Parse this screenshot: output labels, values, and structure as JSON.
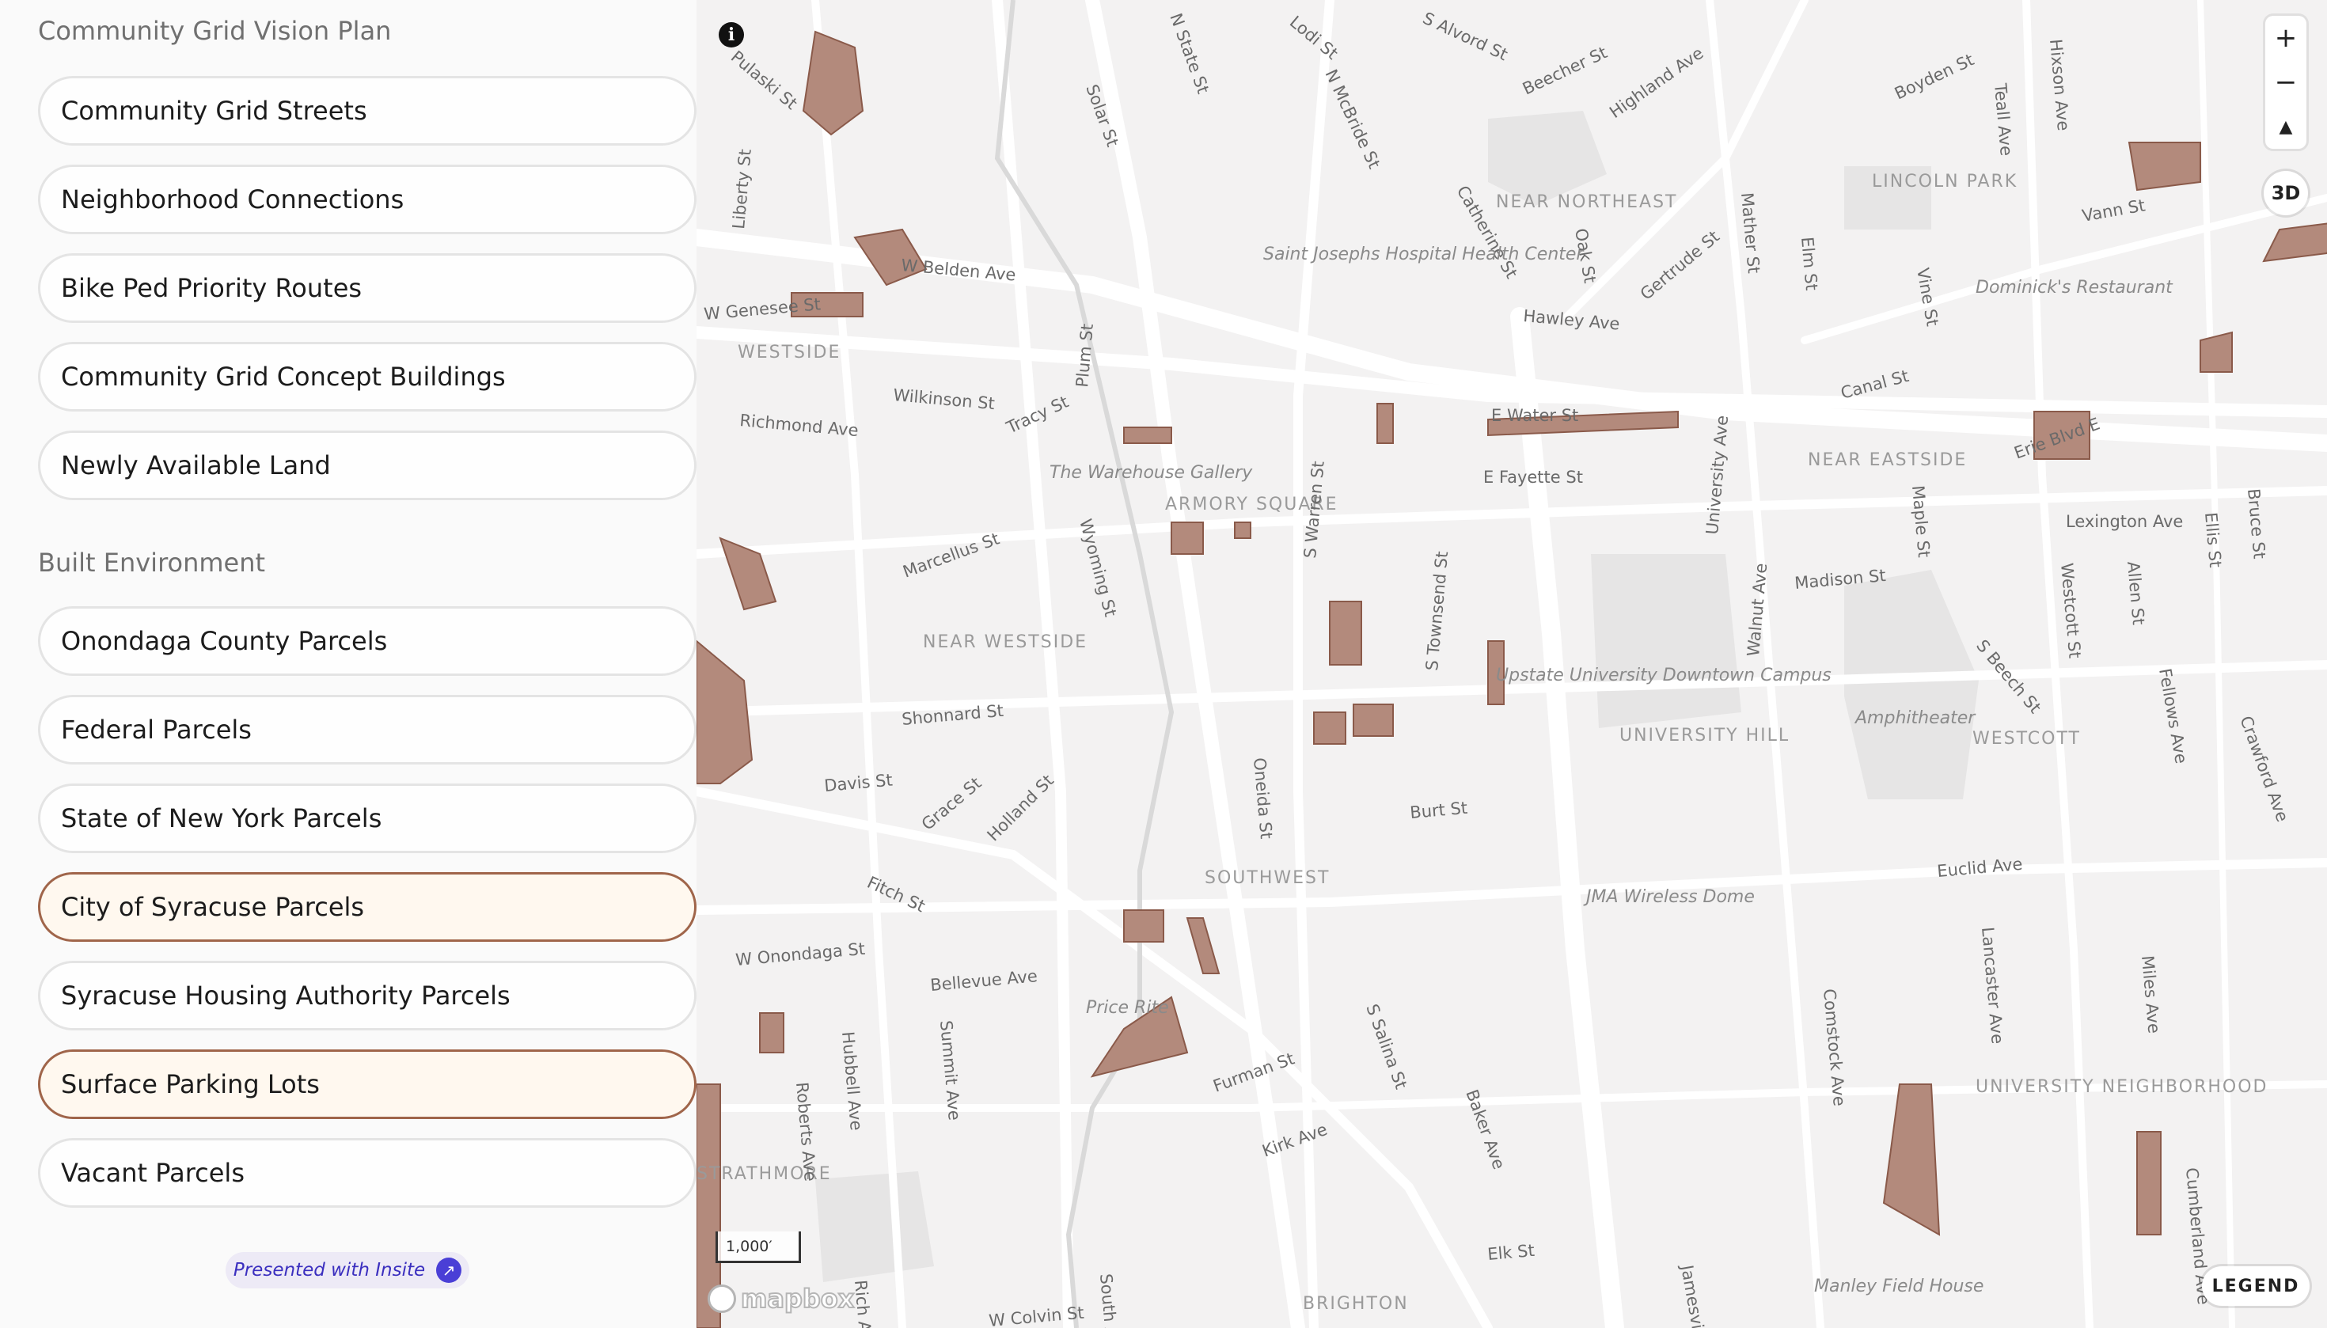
{
  "sidebar": {
    "section_vision": "Community Grid Vision Plan",
    "section_built": "Built Environment",
    "vision_items": [
      {
        "label": "Community Grid Streets",
        "active": false
      },
      {
        "label": "Neighborhood Connections",
        "active": false
      },
      {
        "label": "Bike Ped Priority Routes",
        "active": false
      },
      {
        "label": "Community Grid Concept Buildings",
        "active": false
      },
      {
        "label": "Newly Available Land",
        "active": false
      }
    ],
    "built_items": [
      {
        "label": "Onondaga County Parcels",
        "active": false
      },
      {
        "label": "Federal Parcels",
        "active": false
      },
      {
        "label": "State of New York Parcels",
        "active": false
      },
      {
        "label": "City of Syracuse Parcels",
        "active": true
      },
      {
        "label": "Syracuse Housing Authority Parcels",
        "active": false
      },
      {
        "label": "Surface Parking Lots",
        "active": true
      },
      {
        "label": "Vacant Parcels",
        "active": false
      }
    ],
    "presented_with": "Presented with Insite",
    "presented_icon": "arrow-up-right-icon"
  },
  "map": {
    "controls": {
      "zoom_in": "+",
      "zoom_out": "−",
      "compass": "▲",
      "three_d": "3D",
      "info": "i",
      "legend": "LEGEND"
    },
    "scale": "1,000′",
    "attribution": "mapbox",
    "colors": {
      "parcel_fill": "#b38a7c",
      "parcel_stroke": "#8a5a4a",
      "background": "#f3f2f2",
      "road": "#ffffff",
      "active_border": "#a0654a"
    },
    "neighborhoods": [
      "WESTSIDE",
      "NEAR NORTHEAST",
      "LINCOLN PARK",
      "ARMORY SQUARE",
      "NEAR WESTSIDE",
      "NEAR EASTSIDE",
      "UNIVERSITY HILL",
      "WESTCOTT",
      "SOUTHWEST",
      "UNIVERSITY NEIGHBORHOOD",
      "STRATHMORE",
      "BRIGHTON"
    ],
    "streets": [
      "Pulaski St",
      "N State St",
      "Lodi St",
      "S Alvord St",
      "Beecher St",
      "Highland Ave",
      "Boyden St",
      "Teall Ave",
      "Hixson Ave",
      "Vann St",
      "Solar St",
      "N McBride St",
      "Catherine St",
      "Oak St",
      "Mather St",
      "Elm St",
      "Vine St",
      "Gertrude St",
      "Hawley Ave",
      "Liberty St",
      "W Belden Ave",
      "W Genesee St",
      "Plum St",
      "Wilkinson St",
      "Tracy St",
      "Richmond Ave",
      "E Water St",
      "Canal St",
      "Erie Blvd E",
      "E Fayette St",
      "S Warren St",
      "Marcellus St",
      "Wyoming St",
      "S Townsend St",
      "University Ave",
      "Maple St",
      "Lexington Ave",
      "Ellis St",
      "Bruce St",
      "Madison St",
      "Walnut Ave",
      "Westcott St",
      "Allen St",
      "S Beech St",
      "Fellows Ave",
      "Crawford Ave",
      "Shonnard St",
      "Davis St",
      "Grace St",
      "Holland St",
      "Fitch St",
      "Oneida St",
      "Burt St",
      "Euclid Ave",
      "W Onondaga St",
      "Bellevue Ave",
      "Lancaster Ave",
      "Miles Ave",
      "Hubbell Ave",
      "Summit Ave",
      "Roberts Ave",
      "Furman St",
      "S Salina St",
      "Comstock Ave",
      "Kirk Ave",
      "Baker Ave",
      "Elk St",
      "Cumberland Ave",
      "W Colvin St",
      "South Ave",
      "Jamesville Ave",
      "Rich Ave"
    ],
    "places": [
      "Saint Josephs Hospital Health Center",
      "Dominick's Restaurant",
      "The Warehouse Gallery",
      "Upstate University Downtown Campus",
      "Amphitheater",
      "JMA Wireless Dome",
      "Price Rite",
      "Manley Field House"
    ]
  }
}
